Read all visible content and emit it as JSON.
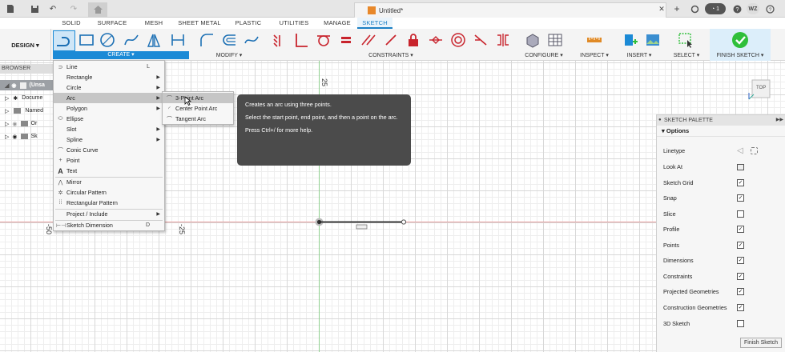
{
  "window": {
    "doc_title": "Untitled*",
    "badge_count": "1",
    "user_initials": "WZ"
  },
  "tabs": [
    {
      "label": "SOLID"
    },
    {
      "label": "SURFACE"
    },
    {
      "label": "MESH"
    },
    {
      "label": "SHEET METAL"
    },
    {
      "label": "PLASTIC"
    },
    {
      "label": "UTILITIES"
    },
    {
      "label": "MANAGE"
    },
    {
      "label": "SKETCH"
    }
  ],
  "ribbon": {
    "workspace": "DESIGN",
    "groups": {
      "create": "CREATE",
      "modify": "MODIFY",
      "constraints": "CONSTRAINTS",
      "configure": "CONFIGURE",
      "inspect": "INSPECT",
      "insert": "INSERT",
      "select": "SELECT",
      "finish": "FINISH SKETCH"
    }
  },
  "browser": {
    "header": "BROWSER",
    "items": [
      {
        "label": "(Unsa"
      },
      {
        "label": "Docume"
      },
      {
        "label": "Named"
      },
      {
        "label": "Or"
      },
      {
        "label": "Sk"
      }
    ]
  },
  "canvas": {
    "ruler_top": "25",
    "ruler_left_a": "-50",
    "ruler_left_b": "-25"
  },
  "create_menu": {
    "items": [
      {
        "label": "Line",
        "shortcut": "L",
        "icon": "line-icon"
      },
      {
        "label": "Rectangle",
        "submenu": true
      },
      {
        "label": "Circle",
        "submenu": true
      },
      {
        "label": "Arc",
        "submenu": true
      },
      {
        "label": "Polygon",
        "submenu": true
      },
      {
        "label": "Ellipse",
        "icon": "ellipse-icon"
      },
      {
        "label": "Slot",
        "submenu": true
      },
      {
        "label": "Spline",
        "submenu": true
      },
      {
        "label": "Conic Curve",
        "icon": "conic-icon"
      },
      {
        "label": "Point",
        "icon": "point-icon"
      },
      {
        "label": "Text",
        "icon": "text-icon"
      },
      {
        "label": "Mirror",
        "icon": "mirror-icon"
      },
      {
        "label": "Circular Pattern",
        "icon": "circular-pattern-icon"
      },
      {
        "label": "Rectangular Pattern",
        "icon": "rectangular-pattern-icon"
      },
      {
        "label": "Project / Include",
        "submenu": true
      },
      {
        "label": "Sketch Dimension",
        "shortcut": "D",
        "icon": "dimension-icon"
      }
    ]
  },
  "arc_submenu": [
    {
      "label": "3-Point Arc"
    },
    {
      "label": "Center Point Arc"
    },
    {
      "label": "Tangent Arc"
    }
  ],
  "tooltip": {
    "title": "Creates an arc using three points.",
    "body": "Select the start point, end point, and then a point on the arc.",
    "hint": "Press Ctrl+/ for more help."
  },
  "palette": {
    "title": "SKETCH PALETTE",
    "section": "Options",
    "rows": [
      {
        "label": "Linetype",
        "checked": null
      },
      {
        "label": "Look At",
        "checked": null
      },
      {
        "label": "Sketch Grid",
        "checked": true
      },
      {
        "label": "Snap",
        "checked": true
      },
      {
        "label": "Slice",
        "checked": false
      },
      {
        "label": "Profile",
        "checked": true
      },
      {
        "label": "Points",
        "checked": true
      },
      {
        "label": "Dimensions",
        "checked": true
      },
      {
        "label": "Constraints",
        "checked": true
      },
      {
        "label": "Projected Geometries",
        "checked": true
      },
      {
        "label": "Construction Geometries",
        "checked": true
      },
      {
        "label": "3D Sketch",
        "checked": false
      }
    ],
    "finish_label": "Finish Sketch"
  },
  "viewcube": {
    "face": "TOP"
  },
  "colors": {
    "accent": "#1b8ad6",
    "finish_green": "#2fbf3a",
    "constraint_red": "#c8232c"
  }
}
